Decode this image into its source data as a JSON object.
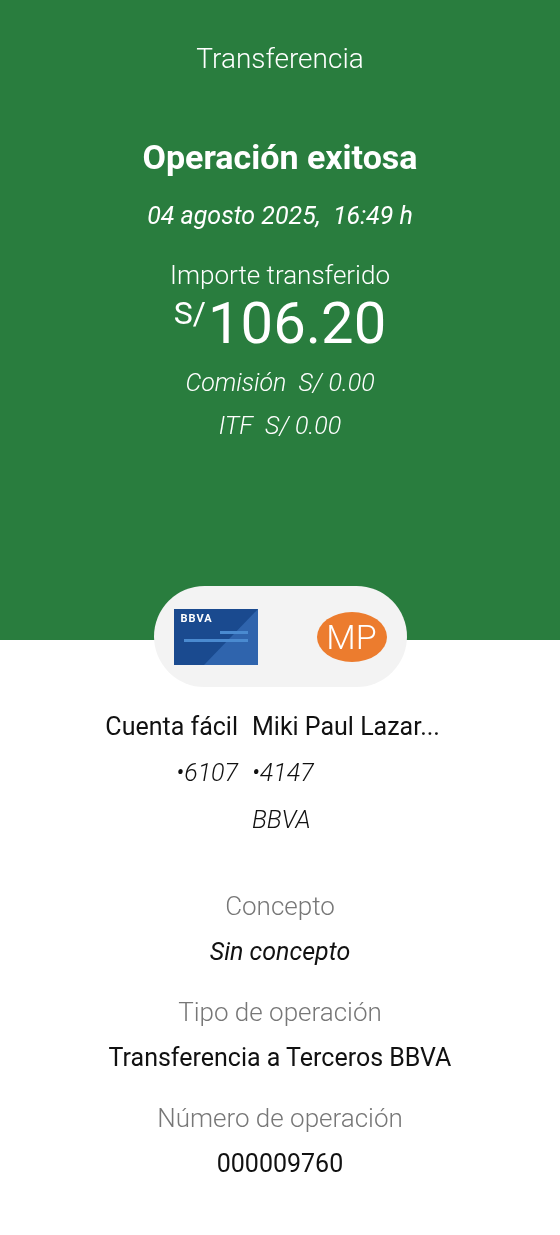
{
  "header": {
    "title": "Transferencia",
    "status": "Operación exitosa",
    "datetime": "04 agosto 2025,  16:49 h",
    "amount_label": "Importe transferido",
    "currency": "S/",
    "amount": "106.20",
    "fees": [
      "Comisión  S/ 0.00",
      "ITF  S/ 0.00"
    ]
  },
  "transfer": {
    "origin": {
      "card_brand": "BBVA",
      "name": "Cuenta fácil",
      "lines": [
        "•6107"
      ]
    },
    "destination": {
      "initials": "MP",
      "name": "Miki Paul Lazar...",
      "lines": [
        "•4147",
        "BBVA"
      ]
    }
  },
  "details": [
    {
      "label": "Concepto",
      "value": "Sin concepto",
      "italic": true
    },
    {
      "label": "Tipo de operación",
      "value": "Transferencia a Terceros BBVA",
      "italic": false
    },
    {
      "label": "Número de operación",
      "value": "000009760",
      "italic": false
    }
  ]
}
